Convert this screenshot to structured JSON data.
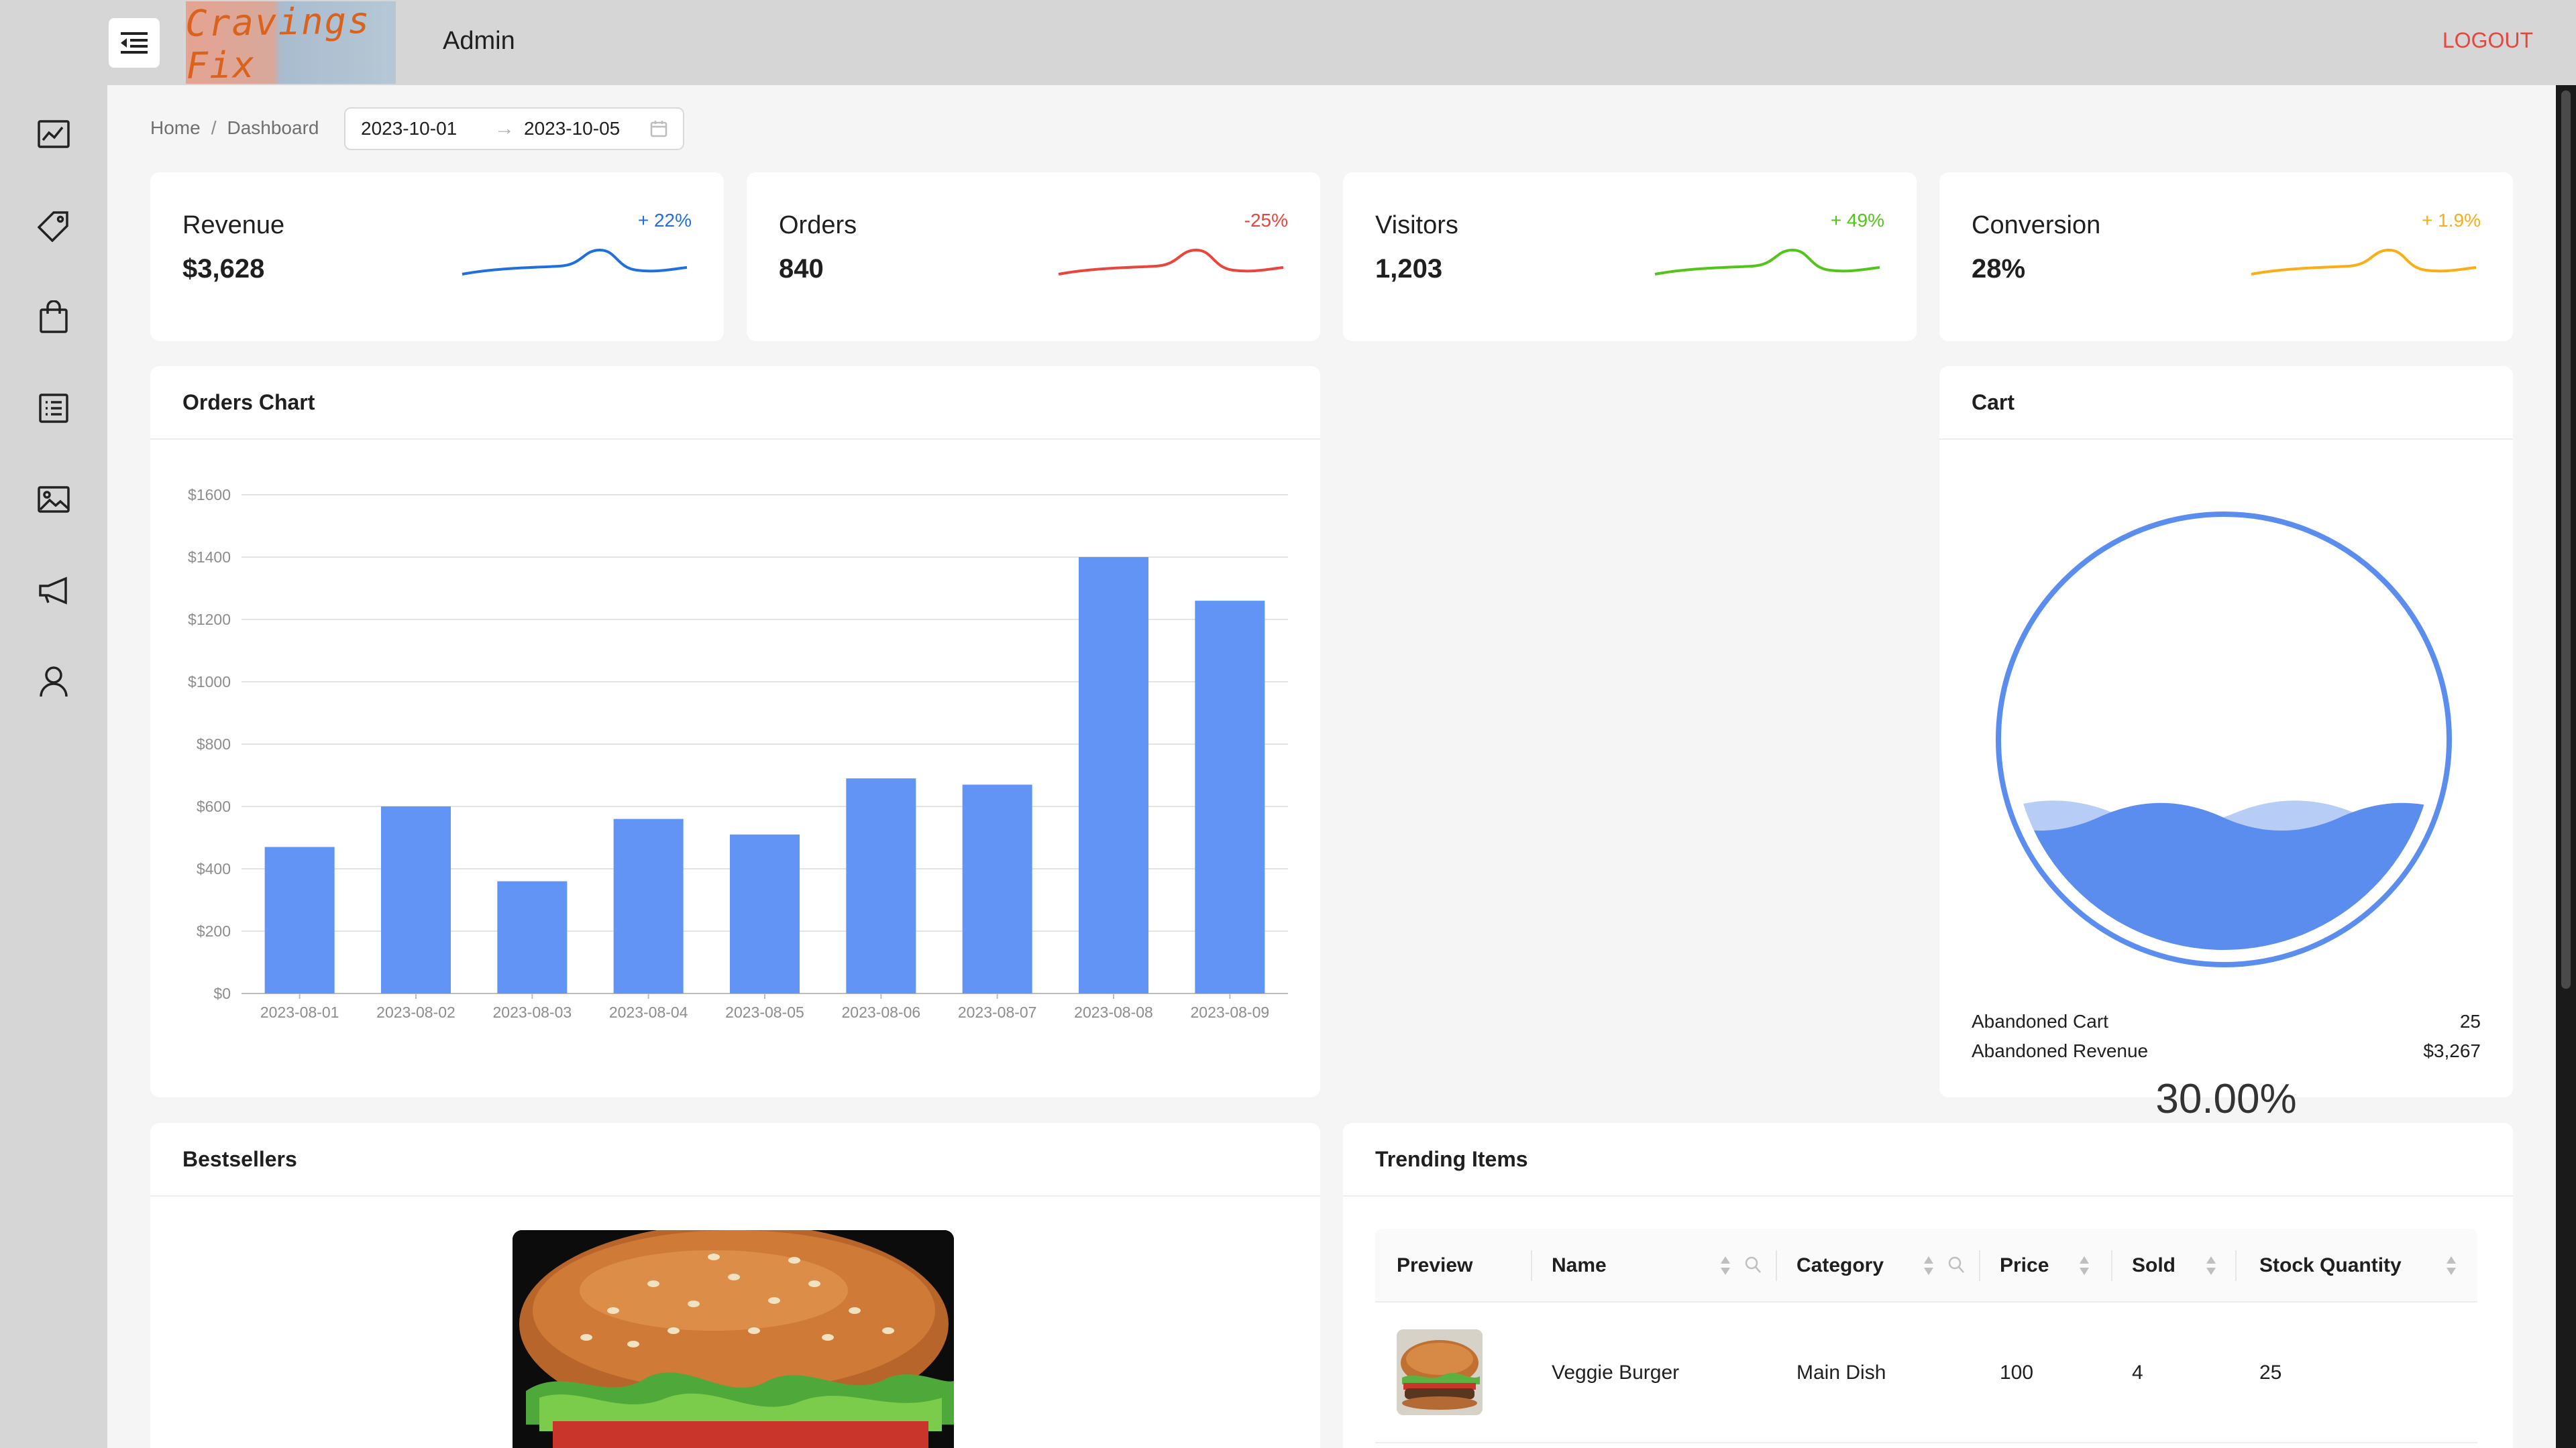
{
  "header": {
    "brand": "Cravings Fix",
    "role": "Admin",
    "logout_label": "LOGOUT"
  },
  "sidebar": {
    "items": [
      {
        "icon": "line-chart-icon"
      },
      {
        "icon": "tag-icon"
      },
      {
        "icon": "shopping-bag-icon"
      },
      {
        "icon": "list-icon"
      },
      {
        "icon": "image-icon"
      },
      {
        "icon": "megaphone-icon"
      },
      {
        "icon": "user-icon"
      }
    ]
  },
  "breadcrumb": {
    "home": "Home",
    "separator": "/",
    "current": "Dashboard"
  },
  "date_range": {
    "start": "2023-10-01",
    "arrow": "→",
    "end": "2023-10-05"
  },
  "stats": [
    {
      "title": "Revenue",
      "value": "$3,628",
      "change": "+ 22%",
      "color": "#1f6fde"
    },
    {
      "title": "Orders",
      "value": "840",
      "change": "-25%",
      "color": "#e8453c"
    },
    {
      "title": "Visitors",
      "value": "1,203",
      "change": "+ 49%",
      "color": "#52c41a"
    },
    {
      "title": "Conversion",
      "value": "28%",
      "change": "+ 1.9%",
      "color": "#faad14"
    }
  ],
  "orders_chart": {
    "title": "Orders Chart"
  },
  "chart_data": {
    "type": "bar",
    "categories": [
      "2023-08-01",
      "2023-08-02",
      "2023-08-03",
      "2023-08-04",
      "2023-08-05",
      "2023-08-06",
      "2023-08-07",
      "2023-08-08",
      "2023-08-09"
    ],
    "values": [
      470,
      600,
      360,
      560,
      510,
      690,
      670,
      1400,
      1260
    ],
    "ylim": [
      0,
      1600
    ],
    "yticks": [
      "$0",
      "$200",
      "$400",
      "$600",
      "$800",
      "$1000",
      "$1200",
      "$1400",
      "$1600"
    ],
    "color": "#6294f5",
    "grid": true
  },
  "cart": {
    "title": "Cart",
    "percent": "30.00%",
    "fill_fraction": 0.3,
    "abandoned_cart_label": "Abandoned Cart",
    "abandoned_cart_value": "25",
    "abandoned_revenue_label": "Abandoned Revenue",
    "abandoned_revenue_value": "$3,267"
  },
  "bestsellers": {
    "title": "Bestsellers"
  },
  "trending": {
    "title": "Trending Items",
    "columns": [
      "Preview",
      "Name",
      "Category",
      "Price",
      "Sold",
      "Stock Quantity"
    ],
    "rows": [
      {
        "name": "Veggie Burger",
        "category": "Main Dish",
        "price": "100",
        "sold": "4",
        "stock": "25"
      }
    ]
  }
}
